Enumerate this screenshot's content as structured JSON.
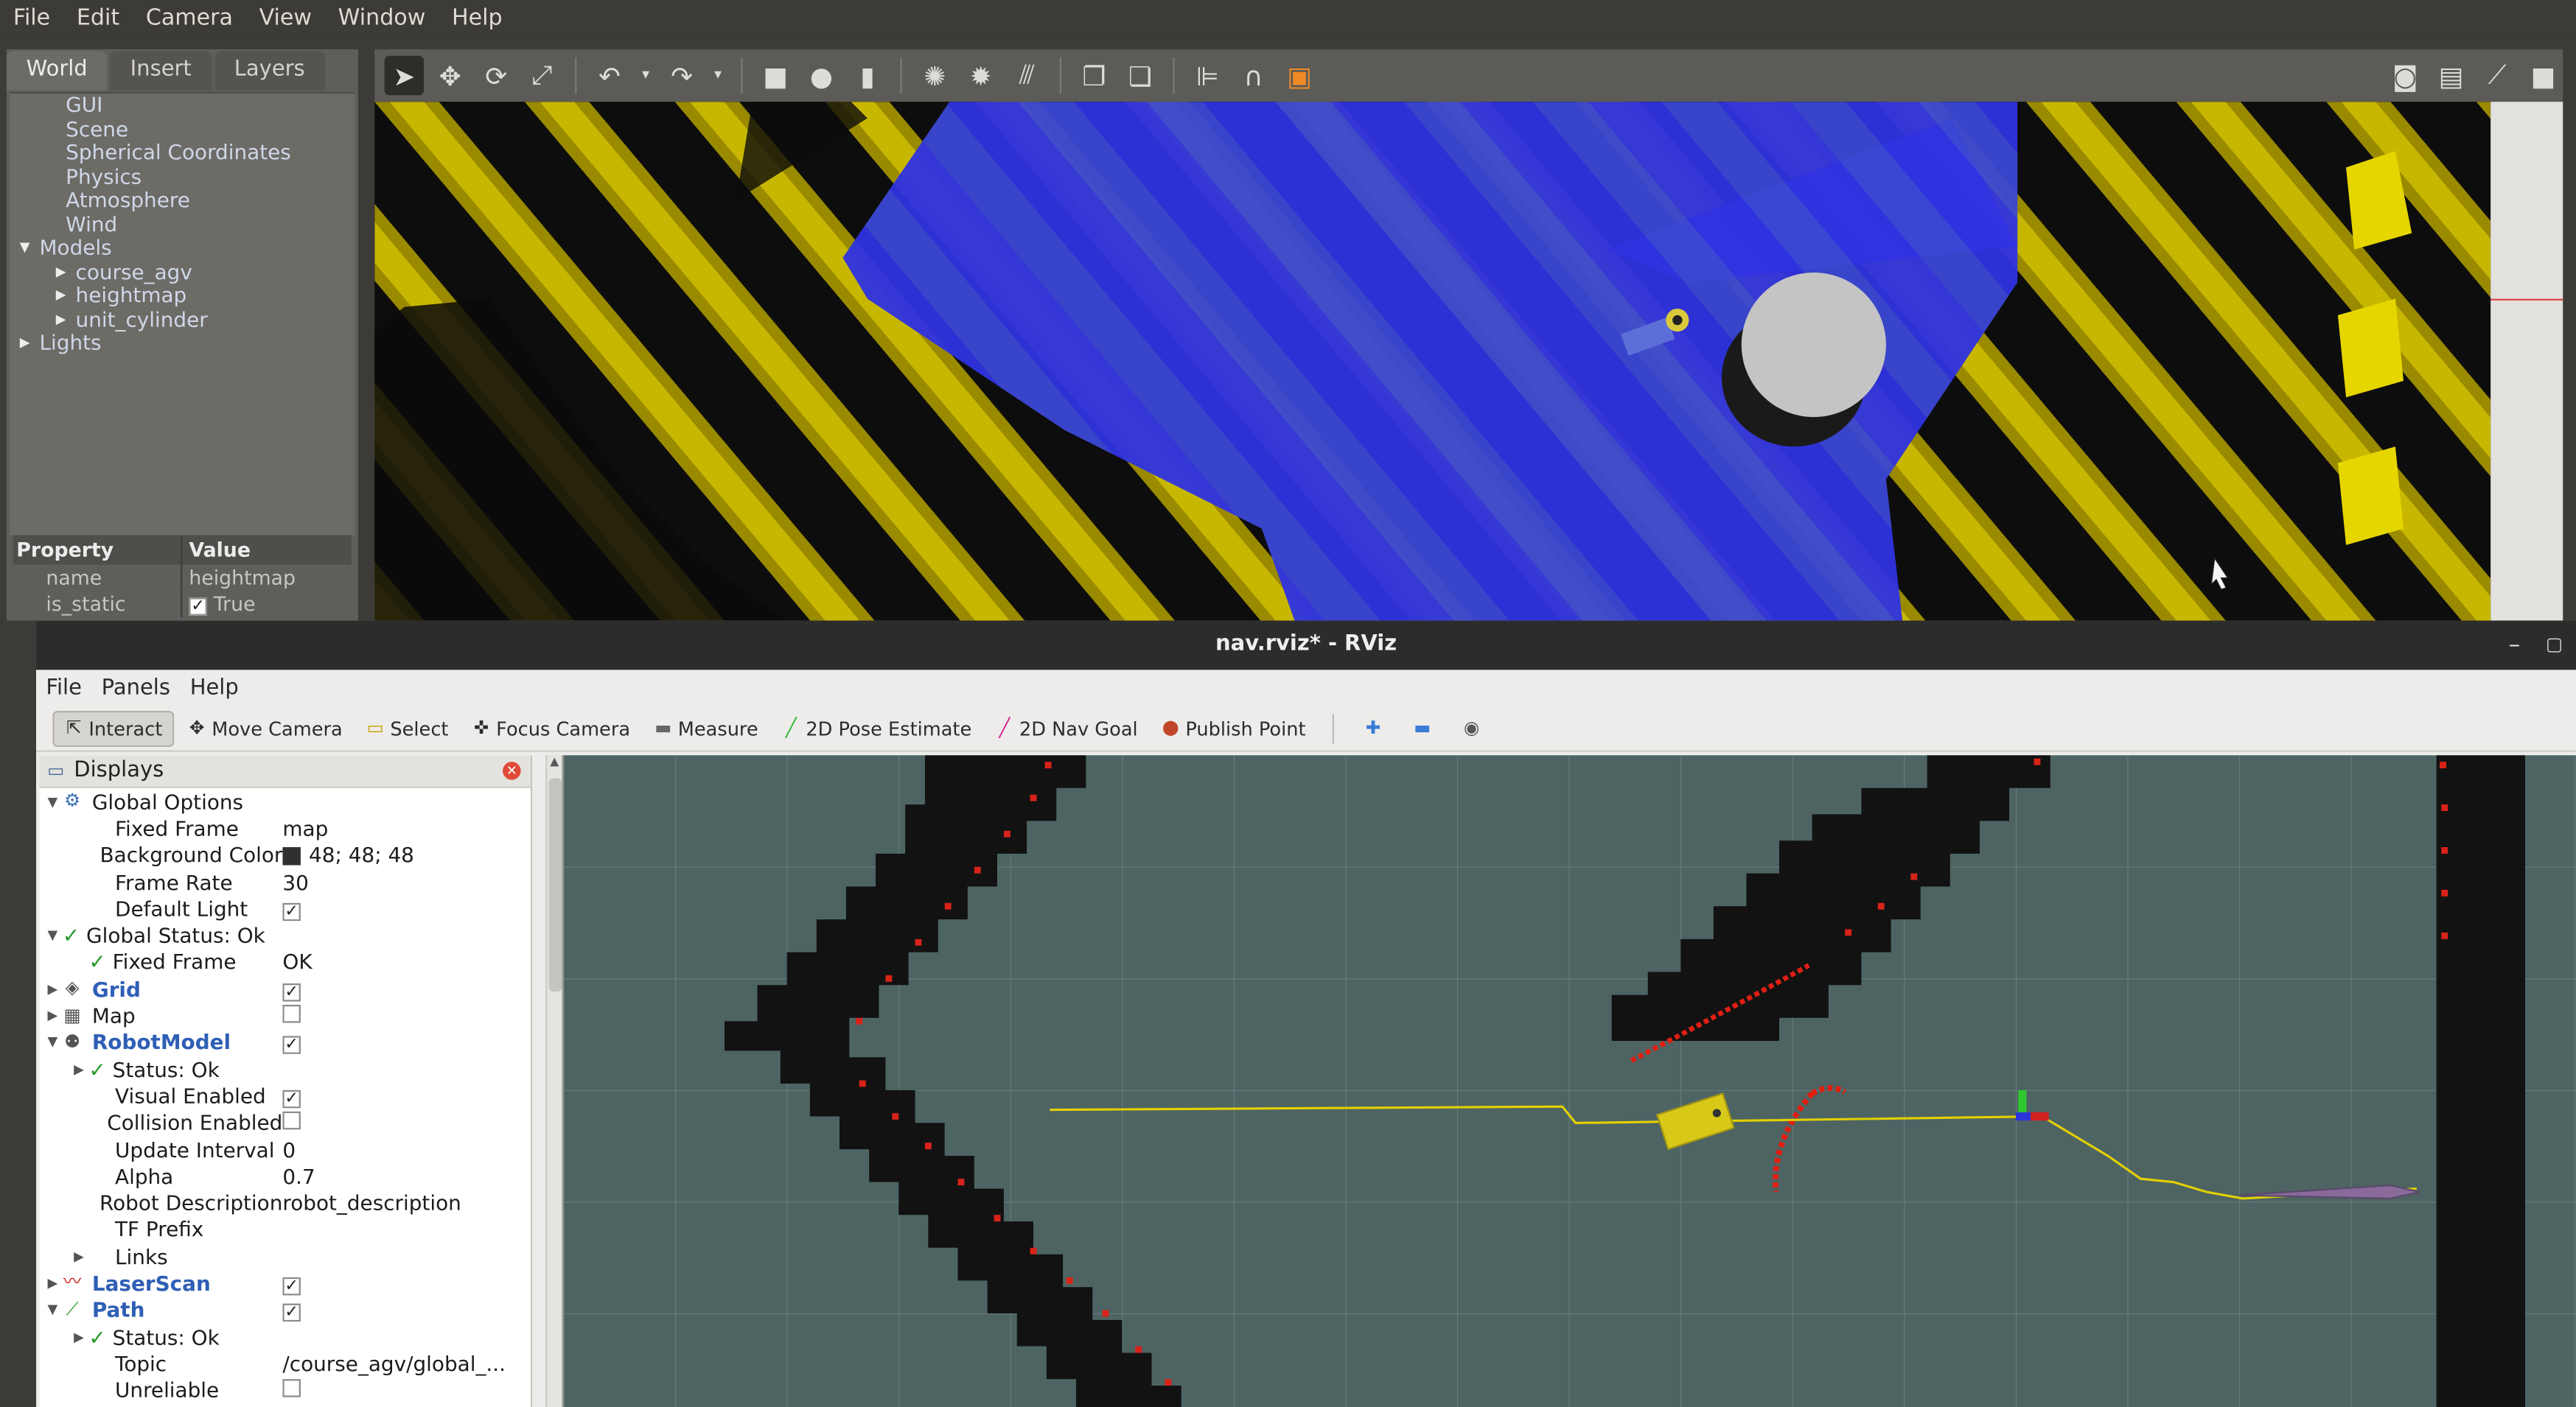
{
  "gazebo": {
    "menu": [
      "File",
      "Edit",
      "Camera",
      "View",
      "Window",
      "Help"
    ],
    "tabs": [
      "World",
      "Insert",
      "Layers"
    ],
    "world_tree": [
      {
        "label": "GUI",
        "indent": 1,
        "arrow": ""
      },
      {
        "label": "Scene",
        "indent": 1,
        "arrow": ""
      },
      {
        "label": "Spherical Coordinates",
        "indent": 1,
        "arrow": ""
      },
      {
        "label": "Physics",
        "indent": 1,
        "arrow": ""
      },
      {
        "label": "Atmosphere",
        "indent": 1,
        "arrow": ""
      },
      {
        "label": "Wind",
        "indent": 1,
        "arrow": ""
      },
      {
        "label": "Models",
        "indent": 0,
        "arrow": "down"
      },
      {
        "label": "course_agv",
        "indent": 2,
        "arrow": "right"
      },
      {
        "label": "heightmap",
        "indent": 2,
        "arrow": "right"
      },
      {
        "label": "unit_cylinder",
        "indent": 2,
        "arrow": "right"
      },
      {
        "label": "Lights",
        "indent": 0,
        "arrow": "right"
      }
    ],
    "property_header": {
      "col1": "Property",
      "col2": "Value"
    },
    "properties": [
      {
        "name": "name",
        "value": "heightmap",
        "checkbox": false
      },
      {
        "name": "is_static",
        "value": "True",
        "checkbox": true
      }
    ],
    "toolbar_icons": [
      "select-arrow-icon",
      "translate-icon",
      "rotate-icon",
      "scale-icon",
      "undo-icon",
      "redo-icon",
      "box-icon",
      "sphere-icon",
      "cylinder-icon",
      "point-light-icon",
      "spot-light-icon",
      "directional-light-icon",
      "copy-icon",
      "paste-icon",
      "align-icon",
      "snap-icon",
      "change-view-icon",
      "screenshot-icon",
      "log-icon",
      "plot-icon",
      "record-icon"
    ]
  },
  "rviz": {
    "title": "nav.rviz* - RViz",
    "menu": [
      "File",
      "Panels",
      "Help"
    ],
    "tools": [
      {
        "label": "Interact",
        "icon": "interact-icon",
        "selected": true
      },
      {
        "label": "Move Camera",
        "icon": "move-camera-icon",
        "selected": false
      },
      {
        "label": "Select",
        "icon": "select-icon",
        "selected": false
      },
      {
        "label": "Focus Camera",
        "icon": "focus-camera-icon",
        "selected": false
      },
      {
        "label": "Measure",
        "icon": "measure-icon",
        "selected": false
      },
      {
        "label": "2D Pose Estimate",
        "icon": "pose-estimate-icon",
        "selected": false
      },
      {
        "label": "2D Nav Goal",
        "icon": "nav-goal-icon",
        "selected": false
      },
      {
        "label": "Publish Point",
        "icon": "publish-point-icon",
        "selected": false
      }
    ],
    "displays_title": "Displays",
    "displays": [
      {
        "label": "Global Options",
        "indent": 0,
        "arrow": "down",
        "icon": "globe",
        "value": "",
        "check": null,
        "status": false,
        "blue": false
      },
      {
        "label": "Fixed Frame",
        "indent": 1,
        "arrow": "",
        "icon": "",
        "value": "map",
        "check": null,
        "status": false,
        "blue": false
      },
      {
        "label": "Background Color",
        "indent": 1,
        "arrow": "",
        "icon": "",
        "value": "48; 48; 48",
        "swatch": "#303030",
        "check": null,
        "status": false,
        "blue": false
      },
      {
        "label": "Frame Rate",
        "indent": 1,
        "arrow": "",
        "icon": "",
        "value": "30",
        "check": null,
        "status": false,
        "blue": false
      },
      {
        "label": "Default Light",
        "indent": 1,
        "arrow": "",
        "icon": "",
        "value": "",
        "check": true,
        "status": false,
        "blue": false
      },
      {
        "label": "Global Status: Ok",
        "indent": 0,
        "arrow": "down",
        "icon": "",
        "value": "",
        "check": null,
        "status": true,
        "blue": false
      },
      {
        "label": "Fixed Frame",
        "indent": 1,
        "arrow": "",
        "icon": "",
        "value": "OK",
        "check": null,
        "status": true,
        "blue": false
      },
      {
        "label": "Grid",
        "indent": 0,
        "arrow": "right",
        "icon": "grid",
        "value": "",
        "check": true,
        "status": false,
        "blue": true
      },
      {
        "label": "Map",
        "indent": 0,
        "arrow": "right",
        "icon": "map",
        "value": "",
        "check": false,
        "status": false,
        "blue": false
      },
      {
        "label": "RobotModel",
        "indent": 0,
        "arrow": "down",
        "icon": "robot",
        "value": "",
        "check": true,
        "status": false,
        "blue": true
      },
      {
        "label": "Status: Ok",
        "indent": 1,
        "arrow": "right",
        "icon": "",
        "value": "",
        "check": null,
        "status": true,
        "blue": false
      },
      {
        "label": "Visual Enabled",
        "indent": 1,
        "arrow": "",
        "icon": "",
        "value": "",
        "check": true,
        "status": false,
        "blue": false
      },
      {
        "label": "Collision Enabled",
        "indent": 1,
        "arrow": "",
        "icon": "",
        "value": "",
        "check": false,
        "status": false,
        "blue": false
      },
      {
        "label": "Update Interval",
        "indent": 1,
        "arrow": "",
        "icon": "",
        "value": "0",
        "check": null,
        "status": false,
        "blue": false
      },
      {
        "label": "Alpha",
        "indent": 1,
        "arrow": "",
        "icon": "",
        "value": "0.7",
        "check": null,
        "status": false,
        "blue": false
      },
      {
        "label": "Robot Description",
        "indent": 1,
        "arrow": "",
        "icon": "",
        "value": "robot_description",
        "check": null,
        "status": false,
        "blue": false
      },
      {
        "label": "TF Prefix",
        "indent": 1,
        "arrow": "",
        "icon": "",
        "value": "",
        "check": null,
        "status": false,
        "blue": false
      },
      {
        "label": "Links",
        "indent": 1,
        "arrow": "right",
        "icon": "",
        "value": "",
        "check": null,
        "status": false,
        "blue": false
      },
      {
        "label": "LaserScan",
        "indent": 0,
        "arrow": "right",
        "icon": "laser",
        "value": "",
        "check": true,
        "status": false,
        "blue": true
      },
      {
        "label": "Path",
        "indent": 0,
        "arrow": "down",
        "icon": "path",
        "value": "",
        "check": true,
        "status": false,
        "blue": true
      },
      {
        "label": "Status: Ok",
        "indent": 1,
        "arrow": "right",
        "icon": "",
        "value": "",
        "check": null,
        "status": true,
        "blue": false
      },
      {
        "label": "Topic",
        "indent": 1,
        "arrow": "",
        "icon": "",
        "value": "/course_agv/global_...",
        "check": null,
        "status": false,
        "blue": false
      },
      {
        "label": "Unreliable",
        "indent": 1,
        "arrow": "",
        "icon": "",
        "value": "",
        "check": false,
        "status": false,
        "blue": false
      }
    ]
  },
  "colors": {
    "scan_blue": "#2a2ee8",
    "heightmap_yellow": "#c7b300",
    "rviz_bg": "#4d6463",
    "path_yellow": "#e2d000",
    "laser_red": "#e01e12"
  }
}
